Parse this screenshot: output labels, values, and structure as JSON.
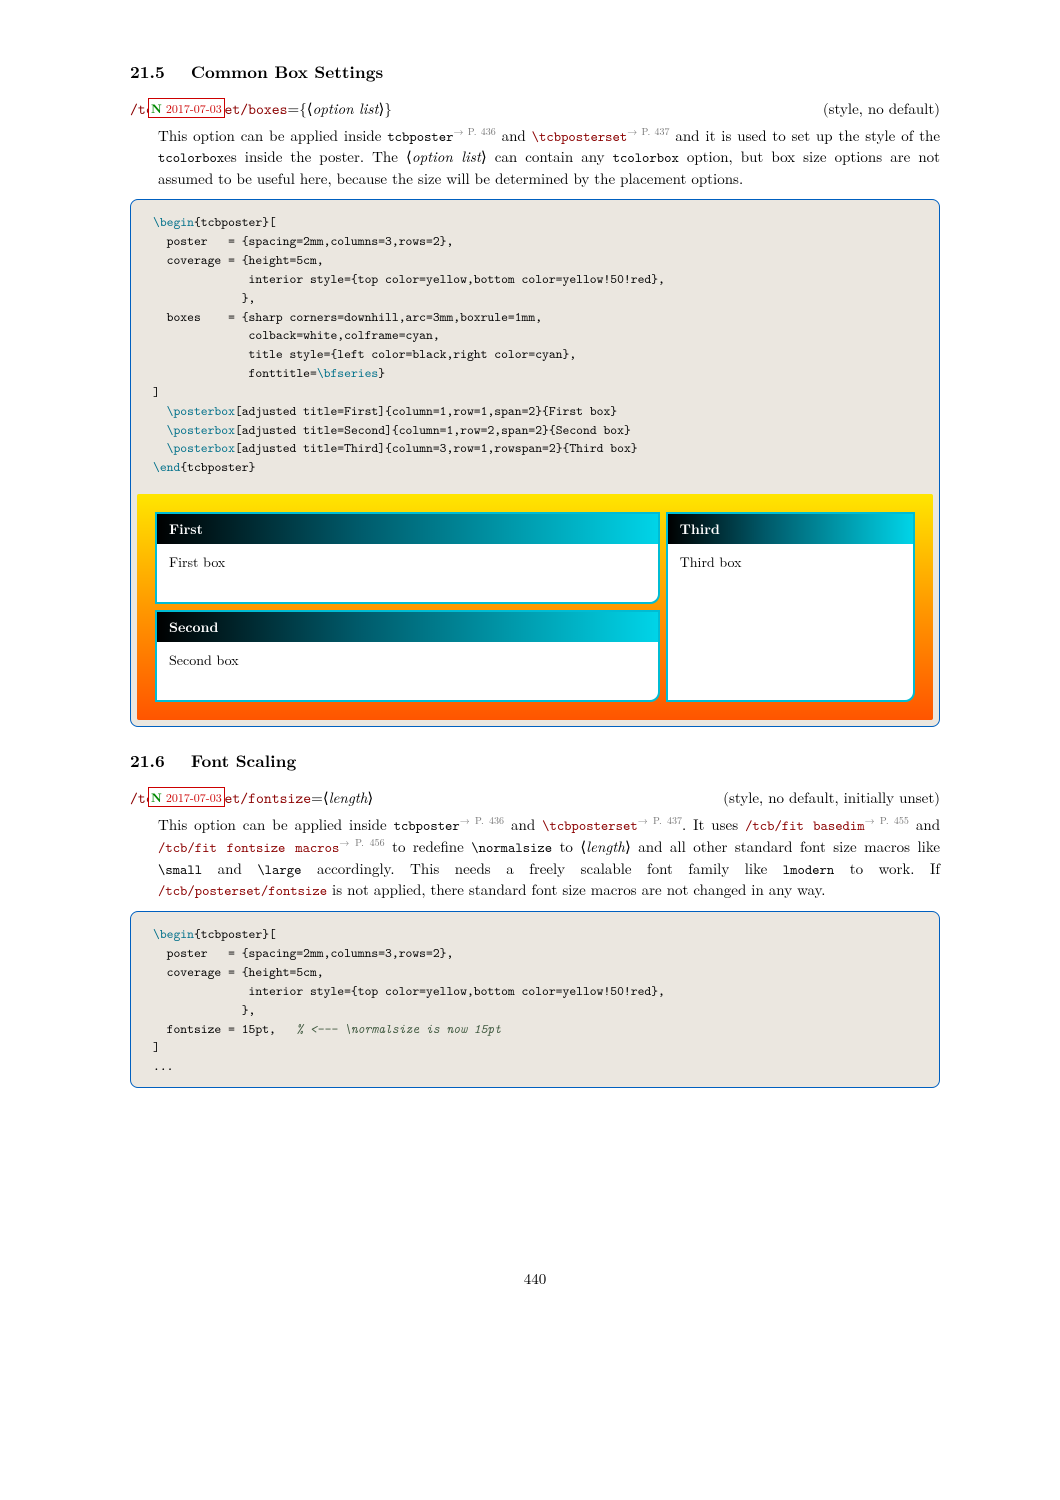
{
  "sections": {
    "s1": {
      "number": "21.5",
      "title": "Common Box Settings",
      "tag_new": "N",
      "tag_date": "2017-07-03",
      "key_path": "/tcb/posterset/",
      "key_name": "boxes",
      "key_arg_open": "={⟨",
      "key_arg": "option list",
      "key_arg_close": "⟩}",
      "definition": "(style, no default)",
      "desc_t1": "This option can be applied inside ",
      "desc_tt1": "tcbposter",
      "desc_ref1": "→ P. 436",
      "desc_t2": " and ",
      "desc_tt2": "\\tcbposterset",
      "desc_ref2": "→ P. 437",
      "desc_t3": " and it is used to set up the style of the ",
      "desc_tt3": "tcolorbox",
      "desc_t4": "es inside the poster. The ⟨",
      "desc_em1": "option list",
      "desc_t5": "⟩ can contain any ",
      "desc_tt4": "tcolorbox",
      "desc_t6": " option, but box size options are not assumed to be useful here, because the size will be determined by the placement options."
    },
    "s2": {
      "number": "21.6",
      "title": "Font Scaling",
      "tag_new": "N",
      "tag_date": "2017-07-03",
      "key_path": "/tcb/posterset/",
      "key_name": "fontsize",
      "key_arg_open": "=⟨",
      "key_arg": "length",
      "key_arg_close": "⟩",
      "definition": "(style, no default, initially unset)",
      "desc_t1": "This option can be applied inside ",
      "desc_tt1": "tcbposter",
      "desc_ref1": "→ P. 436",
      "desc_t2": " and ",
      "desc_tt2": "\\tcbposterset",
      "desc_ref2": "→ P. 437",
      "desc_t3": ". It uses ",
      "desc_tt3": "/tcb/fit basedim",
      "desc_ref3": "→ P. 455",
      "desc_t4": " and ",
      "desc_tt4": "/tcb/fit fontsize macros",
      "desc_ref4": "→ P. 456",
      "desc_t5": " to redefine ",
      "desc_tt5": "\\normalsize",
      "desc_t6": " to ⟨",
      "desc_em1": "length",
      "desc_t7": "⟩ and all other standard font size macros like ",
      "desc_tt6": "\\small",
      "desc_t8": " and ",
      "desc_tt7": "\\large",
      "desc_t9": " accordingly. This needs a freely scalable font family like ",
      "desc_tt8": "lmodern",
      "desc_t10": " to work. If ",
      "desc_tt9": "/tcb/posterset/fontsize",
      "desc_t11": " is not applied, there standard font size macros are not changed in any way."
    }
  },
  "code1": {
    "l1a": "\\begin",
    "l1b": "{tcbposter}[",
    "l2": "  poster   = {spacing=2mm,columns=3,rows=2},",
    "l3": "  coverage = {height=5cm,",
    "l4": "              interior style={top color=yellow,bottom color=yellow!50!red},",
    "l5": "             },",
    "l6": "  boxes    = {sharp corners=downhill,arc=3mm,boxrule=1mm,",
    "l7": "              colback=white,colframe=cyan,",
    "l8": "              title style={left color=black,right color=cyan},",
    "l9": "              fonttitle=",
    "l9b": "\\bfseries",
    "l9c": "}",
    "l10": "]",
    "l11a": "  ",
    "l11b": "\\posterbox",
    "l11c": "[adjusted title=First]{column=1,row=1,span=2}{First box}",
    "l12a": "  ",
    "l12b": "\\posterbox",
    "l12c": "[adjusted title=Second]{column=1,row=2,span=2}{Second box}",
    "l13a": "  ",
    "l13b": "\\posterbox",
    "l13c": "[adjusted title=Third]{column=3,row=1,rowspan=2}{Third box}",
    "l14a": "\\end",
    "l14b": "{tcbposter}"
  },
  "output1": {
    "box1_title": "First",
    "box1_body": "First box",
    "box2_title": "Second",
    "box2_body": "Second box",
    "box3_title": "Third",
    "box3_body": "Third box"
  },
  "code2": {
    "l1a": "\\begin",
    "l1b": "{tcbposter}[",
    "l2": "  poster   = {spacing=2mm,columns=3,rows=2},",
    "l3": "  coverage = {height=5cm,",
    "l4": "              interior style={top color=yellow,bottom color=yellow!50!red},",
    "l5": "             },",
    "l6": "  fontsize = 15pt,   ",
    "l6c": "% <--- \\normalsize is now 15pt",
    "l7": "]",
    "l8": "..."
  },
  "page_number": "440"
}
